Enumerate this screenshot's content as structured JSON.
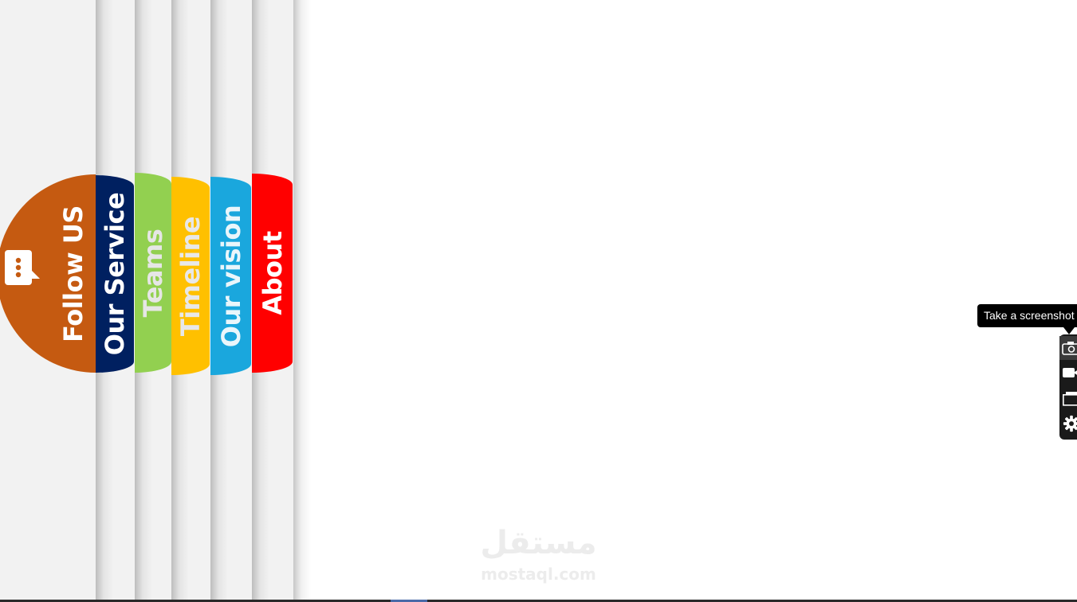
{
  "nav": {
    "follow": {
      "label": "Follow US",
      "color": "#c55a11",
      "icon": "chat-icon"
    },
    "items": [
      {
        "label": "Our Service",
        "color": "#002060"
      },
      {
        "label": "Teams",
        "color": "#92d050"
      },
      {
        "label": "Timeline",
        "color": "#ffc000"
      },
      {
        "label": "Our vision",
        "color": "#1aa7dd"
      },
      {
        "label": "About",
        "color": "#ff0000"
      }
    ]
  },
  "watermark": {
    "arabic": "مستقل",
    "latin": "mostaql.com"
  },
  "screenshot_tool": {
    "tooltip": "Take a screenshot",
    "buttons": [
      {
        "icon": "camera-icon"
      },
      {
        "icon": "video-icon"
      },
      {
        "icon": "window-icon"
      },
      {
        "icon": "gear-icon"
      }
    ]
  }
}
